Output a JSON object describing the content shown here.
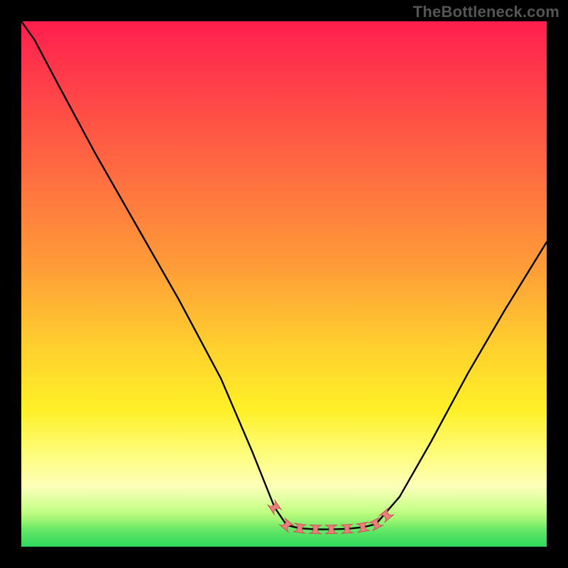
{
  "watermark": {
    "text": "TheBottleneck.com"
  },
  "colors": {
    "page_bg": "#000000",
    "curve": "#000000",
    "marker_fill": "#e97e7b",
    "marker_stroke": "#c45a57",
    "gradient_top": "#ff1e4f",
    "gradient_bottom": "#2fd85d"
  },
  "chart_data": {
    "type": "line",
    "title": "",
    "xlabel": "",
    "ylabel": "",
    "xlim": [
      0,
      100
    ],
    "ylim": [
      0,
      100
    ],
    "note": "Axes are unlabeled in the image; values are read proportionally from the 740×740 plot area. y=0 is the bottom (green), y=100 is the top (red). Lower curve value = better (closer to green).",
    "series": [
      {
        "name": "left-branch",
        "x": [
          0,
          2.5,
          7,
          14,
          22,
          30,
          38,
          44,
          48.2,
          50.5
        ],
        "y": [
          100,
          96.5,
          88,
          75,
          61,
          47,
          32,
          18,
          7.5,
          4.1
        ]
      },
      {
        "name": "flat-basin",
        "x": [
          50.5,
          53,
          56,
          59,
          62,
          65,
          67.5
        ],
        "y": [
          4.1,
          3.5,
          3.3,
          3.3,
          3.4,
          3.7,
          4.3
        ]
      },
      {
        "name": "right-branch",
        "x": [
          67.5,
          72,
          78,
          85,
          92,
          100
        ],
        "y": [
          4.3,
          9.5,
          20,
          33,
          45,
          58
        ]
      }
    ],
    "markers": {
      "name": "basin-markers",
      "style": "pill",
      "points": [
        {
          "x": 48.2,
          "y": 7.5
        },
        {
          "x": 50.5,
          "y": 4.1
        },
        {
          "x": 53.0,
          "y": 3.5
        },
        {
          "x": 56.0,
          "y": 3.3
        },
        {
          "x": 59.0,
          "y": 3.3
        },
        {
          "x": 62.0,
          "y": 3.4
        },
        {
          "x": 65.0,
          "y": 3.7
        },
        {
          "x": 67.5,
          "y": 4.3
        },
        {
          "x": 69.5,
          "y": 6.0
        }
      ]
    }
  }
}
